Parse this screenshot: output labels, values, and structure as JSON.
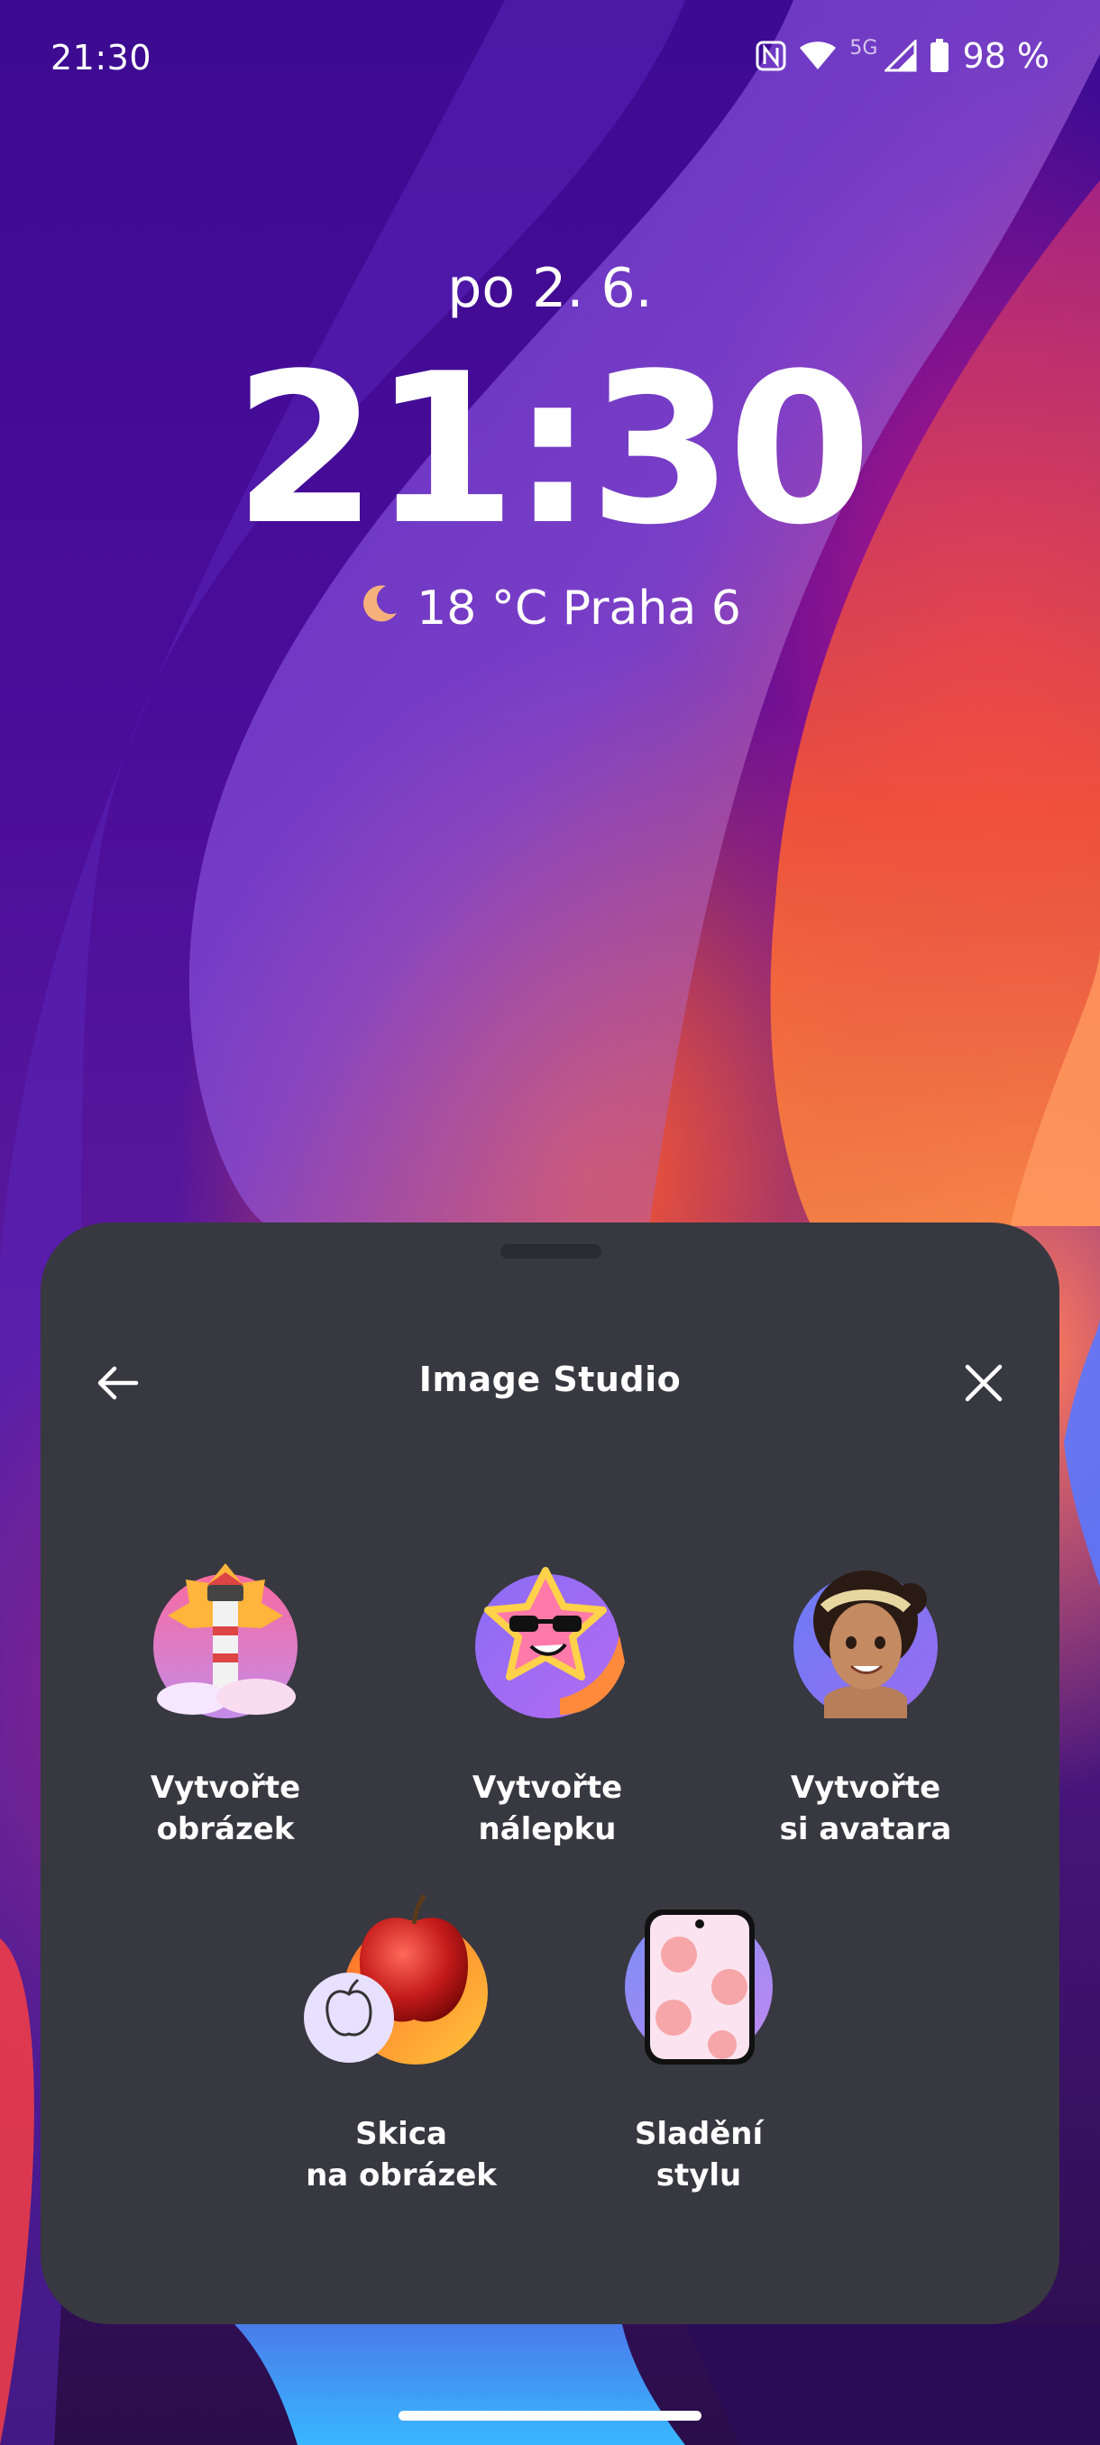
{
  "status_bar": {
    "time": "21:30",
    "network": "5G",
    "battery": "98 %"
  },
  "lock_screen": {
    "date": "po 2. 6.",
    "clock": "21:30",
    "weather": "18 °C Praha 6"
  },
  "sheet": {
    "title": "Image Studio",
    "tools": [
      {
        "line1": "Vytvořte",
        "line2": "obrázek",
        "icon": "lighthouse-icon"
      },
      {
        "line1": "Vytvořte",
        "line2": "nálepku",
        "icon": "star-sticker-icon"
      },
      {
        "line1": "Vytvořte",
        "line2": "si avatara",
        "icon": "avatar-icon"
      },
      {
        "line1": "Skica",
        "line2": "na obrázek",
        "icon": "apple-icon"
      },
      {
        "line1": "Sladění",
        "line2": "stylu",
        "icon": "phone-style-icon"
      }
    ]
  },
  "colors": {
    "sheet_bg": "#373840",
    "accent_purple": "#7b5cf0",
    "accent_pink": "#f07ab4"
  }
}
